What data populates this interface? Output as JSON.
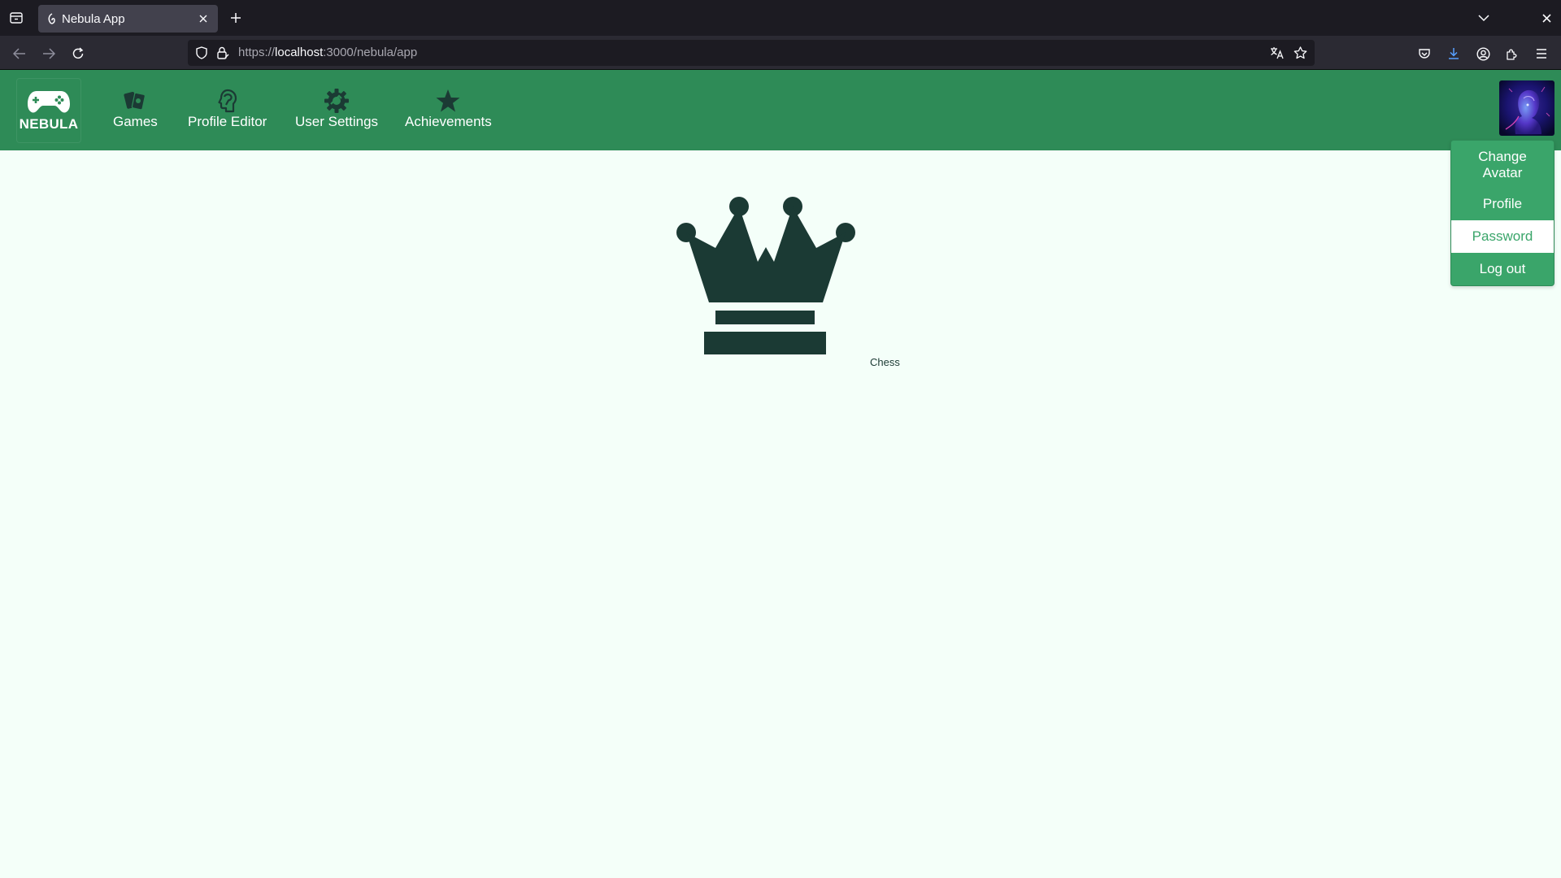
{
  "browser": {
    "tab_title": "Nebula App",
    "url_prefix": "https://",
    "url_host": "localhost",
    "url_rest": ":3000/nebula/app"
  },
  "header": {
    "brand": "NEBULA",
    "menu": [
      {
        "label": "Games",
        "icon": "cards-icon"
      },
      {
        "label": "Profile Editor",
        "icon": "head-profile-icon"
      },
      {
        "label": "User Settings",
        "icon": "gear-icon"
      },
      {
        "label": "Achievements",
        "icon": "star-icon"
      }
    ],
    "avatar": "avatar"
  },
  "dropdown": {
    "change_avatar": "Change Avatar",
    "profile": "Profile",
    "password": "Password",
    "logout": "Log out"
  },
  "games": [
    {
      "label": "Chess",
      "icon": "chess-queen-icon"
    }
  ],
  "colors": {
    "header_bg": "#2e8b57",
    "dropdown_bg": "#3aa56a",
    "page_bg": "#f4fff9",
    "icon_dark": "#1b3a34"
  }
}
